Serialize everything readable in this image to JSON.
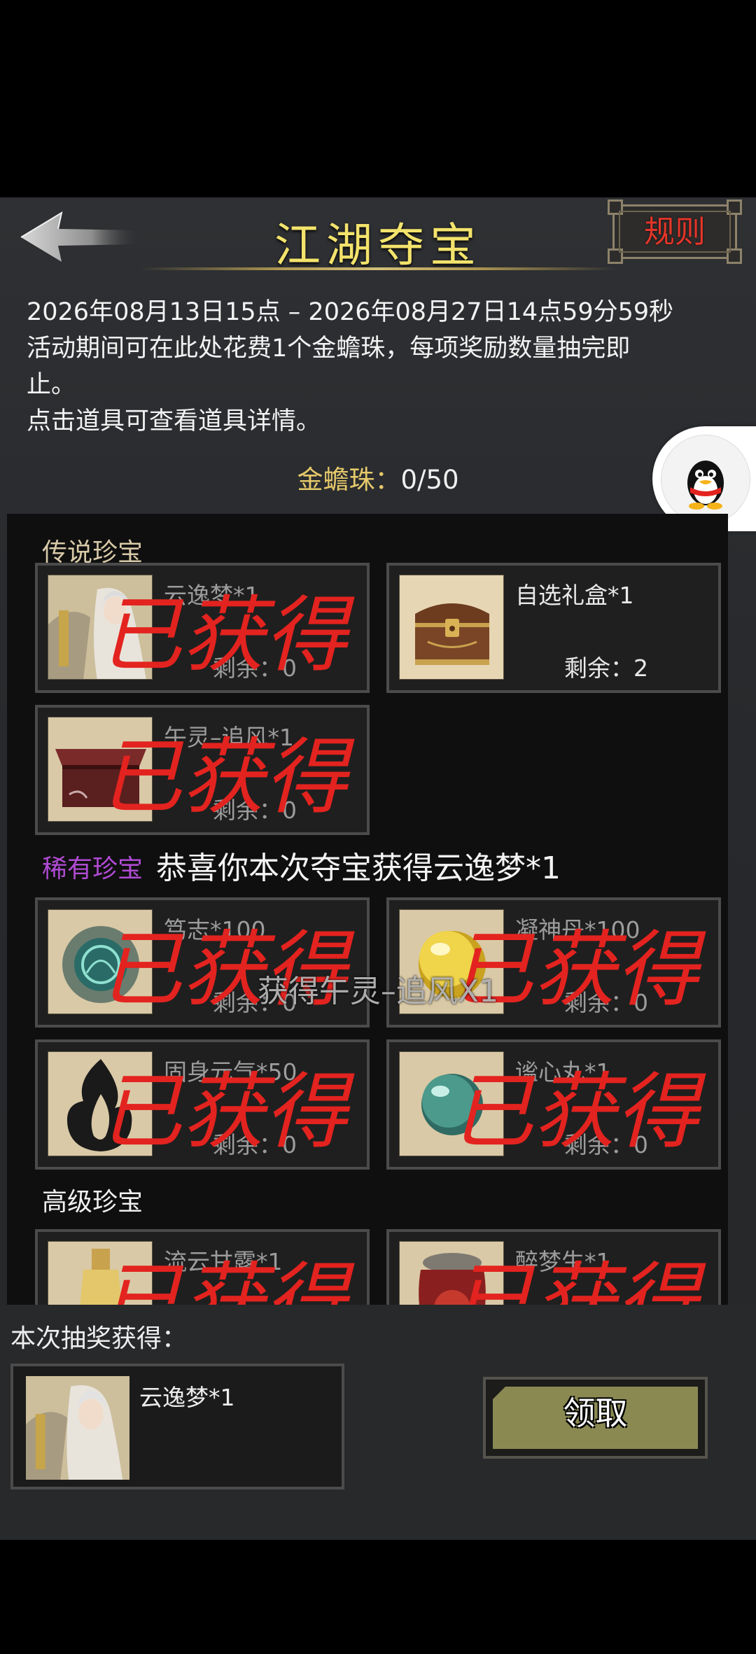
{
  "header": {
    "title": "江湖夺宝",
    "rules_label": "规则"
  },
  "description": {
    "line1": "2026年08月13日15点 – 2026年08月27日14点59分59秒",
    "line2": "活动期间可在此处花费1个金蟾珠，每项奖励数量抽完即",
    "line3": "止。",
    "line4": "点击道具可查看道具详情。"
  },
  "currency": {
    "label": "金蟾珠：",
    "value": "0/50"
  },
  "stamp_text": "已获得",
  "sections": {
    "legendary": "传说珍宝",
    "rare": "稀有珍宝",
    "advanced": "高级珍宝"
  },
  "congrats": "恭喜你本次夺宝获得云逸梦*1",
  "toast": "获得午灵–追风X1",
  "items": [
    {
      "name": "云逸梦*1",
      "remain": "剩余：0",
      "obtained": true
    },
    {
      "name": "自选礼盒*1",
      "remain": "剩余：2",
      "obtained": false
    },
    {
      "name": "午灵–追风*1",
      "remain": "剩余：0",
      "obtained": true
    },
    {
      "name": "笃志*100",
      "remain": "剩余：0",
      "obtained": true
    },
    {
      "name": "凝神丹*100",
      "remain": "剩余：0",
      "obtained": true
    },
    {
      "name": "固身元气*50",
      "remain": "剩余：0",
      "obtained": true
    },
    {
      "name": "谧心丸*1",
      "remain": "剩余：0",
      "obtained": true
    },
    {
      "name": "流云甘露*1",
      "remain": "",
      "obtained": true
    },
    {
      "name": "醉梦生*1",
      "remain": "",
      "obtained": true
    }
  ],
  "bottom": {
    "caption": "本次抽奖获得：",
    "reward_name": "云逸梦*1",
    "claim_label": "领取"
  },
  "colors": {
    "gold": "#f3e36c",
    "stamp_red": "#e3231f",
    "rare_purple": "#b04bd4",
    "button_olive": "#8a8952"
  }
}
